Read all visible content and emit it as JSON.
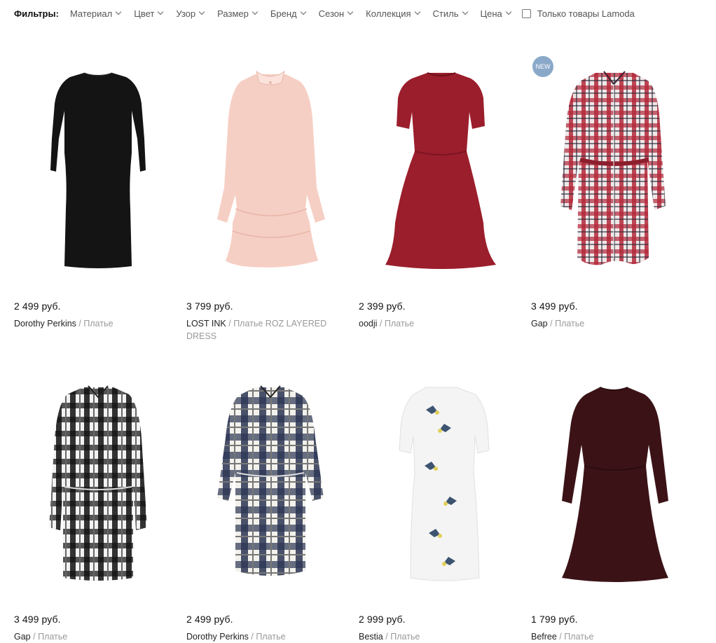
{
  "filters": {
    "title": "Фильтры:",
    "items": [
      "Материал",
      "Цвет",
      "Узор",
      "Размер",
      "Бренд",
      "Сезон",
      "Коллекция",
      "Стиль",
      "Цена"
    ],
    "lamoda_only": "Только товары Lamoda"
  },
  "products": [
    {
      "price": "2 499 руб.",
      "brand": "Dorothy Perkins",
      "sep": "/",
      "type": "Платье",
      "badge": "",
      "image": "black-knit-dress"
    },
    {
      "price": "3 799 руб.",
      "brand": "LOST INK",
      "sep": "/",
      "type": "Платье ROZ LAYERED DRESS",
      "badge": "",
      "image": "pink-layered-dress"
    },
    {
      "price": "2 399 руб.",
      "brand": "oodji",
      "sep": "/",
      "type": "Платье",
      "badge": "",
      "image": "burgundy-leather-dress"
    },
    {
      "price": "3 499 руб.",
      "brand": "Gap",
      "sep": "/",
      "type": "Платье",
      "badge": "NEW",
      "image": "red-plaid-shirt-dress"
    },
    {
      "price": "3 499 руб.",
      "brand": "Gap",
      "sep": "/",
      "type": "Платье",
      "badge": "",
      "image": "black-white-plaid-shirt-dress"
    },
    {
      "price": "2 499 руб.",
      "brand": "Dorothy Perkins",
      "sep": "/",
      "type": "Платье",
      "badge": "",
      "image": "navy-plaid-shirt-dress"
    },
    {
      "price": "2 999 руб.",
      "brand": "Bestia",
      "sep": "/",
      "type": "Платье",
      "badge": "",
      "image": "white-bird-print-dress"
    },
    {
      "price": "1 799 руб.",
      "brand": "Befree",
      "sep": "/",
      "type": "Платье",
      "badge": "",
      "image": "dark-burgundy-knit-dress"
    }
  ],
  "colors": {
    "badge_bg": "#8aa9c9",
    "black_dress": "#141414",
    "pink_dress": "#f6cfc4",
    "burgundy_dress": "#9b1e2c",
    "red_plaid": "#b3283a",
    "navy_plaid": "#2b3553",
    "dark_burgundy": "#3b1317"
  }
}
